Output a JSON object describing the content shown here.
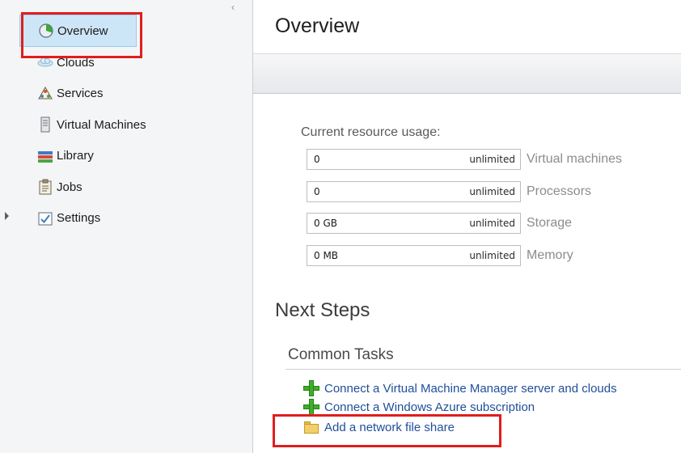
{
  "sidebar": {
    "items": [
      {
        "label": "Overview",
        "icon": "pie-chart-icon",
        "selected": true
      },
      {
        "label": "Clouds",
        "icon": "cloud-icon"
      },
      {
        "label": "Services",
        "icon": "services-icon"
      },
      {
        "label": "Virtual Machines",
        "icon": "server-icon"
      },
      {
        "label": "Library",
        "icon": "books-icon"
      },
      {
        "label": "Jobs",
        "icon": "clipboard-icon"
      },
      {
        "label": "Settings",
        "icon": "checkbox-icon"
      }
    ]
  },
  "main": {
    "title": "Overview",
    "usage": {
      "label": "Current resource usage:",
      "rows": [
        {
          "value": "0",
          "limit": "unlimited",
          "caption": "Virtual machines"
        },
        {
          "value": "0",
          "limit": "unlimited",
          "caption": "Processors"
        },
        {
          "value": "0 GB",
          "limit": "unlimited",
          "caption": "Storage"
        },
        {
          "value": "0 MB",
          "limit": "unlimited",
          "caption": "Memory"
        }
      ]
    },
    "next_steps": "Next Steps",
    "common_tasks": "Common Tasks",
    "tasks": [
      {
        "label": "Connect a Virtual Machine Manager server and clouds",
        "icon": "green-plus-icon"
      },
      {
        "label": "Connect a Windows Azure subscription",
        "icon": "green-plus-icon"
      },
      {
        "label": "Add a network file share",
        "icon": "folder-icon"
      }
    ]
  },
  "colors": {
    "highlight": "#e01d1d",
    "link": "#1f4e9a",
    "selected_bg": "#cde6f7"
  }
}
